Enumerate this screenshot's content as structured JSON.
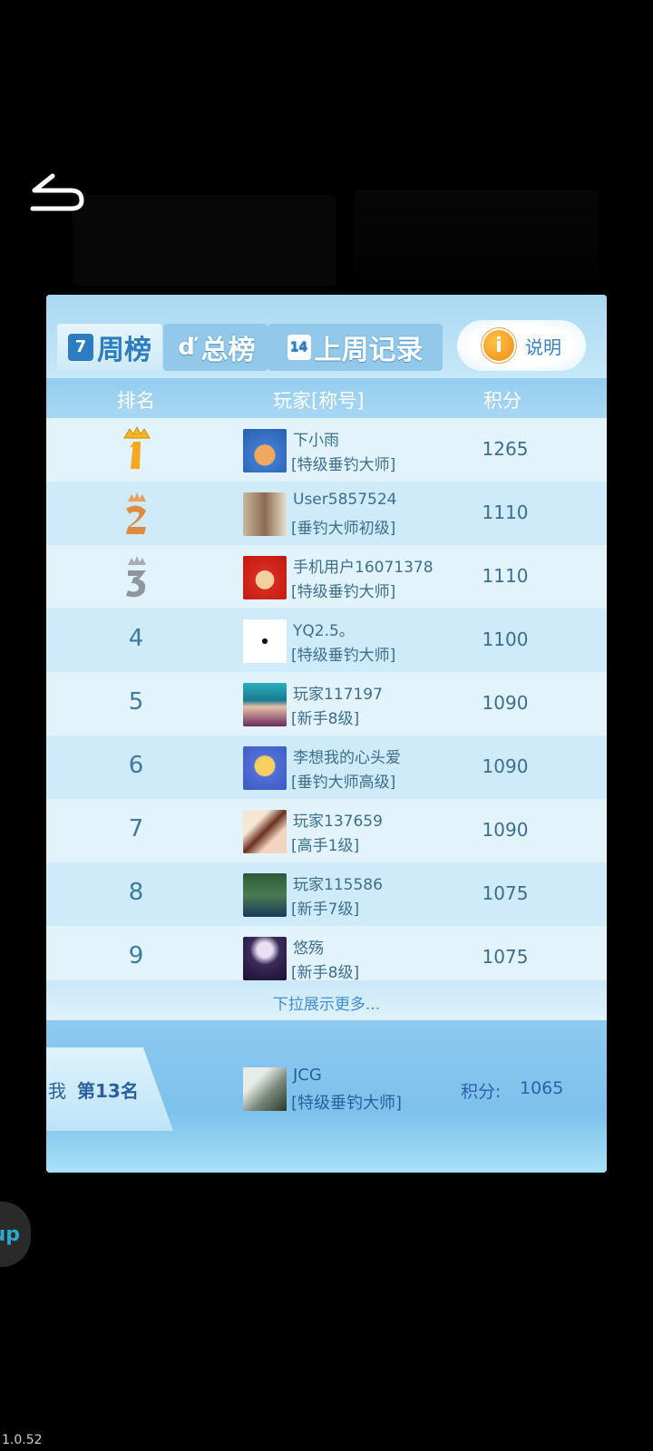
{
  "tabs": [
    {
      "icon_text": "7",
      "label": "周榜",
      "active": true
    },
    {
      "icon_text": "ď",
      "label": "总榜",
      "active": false
    },
    {
      "icon_text": "14",
      "label": "上周记录",
      "active": false
    }
  ],
  "help": {
    "icon": "info-icon",
    "icon_text": "i",
    "label": "说明"
  },
  "columns": {
    "rank": "排名",
    "player": "玩家[称号]",
    "score": "积分"
  },
  "players": [
    {
      "rank": "1",
      "name": "下小雨",
      "title": "[特级垂钓大师]",
      "score": "1265"
    },
    {
      "rank": "2",
      "name": "User5857524",
      "title": "[垂钓大师初级]",
      "score": "1110"
    },
    {
      "rank": "3",
      "name": "手机用户16071378",
      "title": "[特级垂钓大师]",
      "score": "1110"
    },
    {
      "rank": "4",
      "name": "YQ2.5。",
      "title": "[特级垂钓大师]",
      "score": "1100"
    },
    {
      "rank": "5",
      "name": "玩家117197",
      "title": "[新手8级]",
      "score": "1090"
    },
    {
      "rank": "6",
      "name": "李想我的心头爱",
      "title": "[垂钓大师高级]",
      "score": "1090"
    },
    {
      "rank": "7",
      "name": "玩家137659",
      "title": "[高手1级]",
      "score": "1090"
    },
    {
      "rank": "8",
      "name": "玩家115586",
      "title": "[新手7级]",
      "score": "1075"
    },
    {
      "rank": "9",
      "name": "悠殇",
      "title": "[新手8级]",
      "score": "1075"
    }
  ],
  "more_text": "下拉展示更多...",
  "me": {
    "label": "我",
    "rank_text": "第13名",
    "name": "JCG",
    "title": "[特级垂钓大师]",
    "score_label": "积分:",
    "score": "1065"
  },
  "float_button": "up",
  "version": "1.0.52",
  "colors": {
    "accent": "#2d7cc0",
    "gold": "#f0a820",
    "bronze": "#e08840",
    "silver": "#9aa0a8"
  }
}
